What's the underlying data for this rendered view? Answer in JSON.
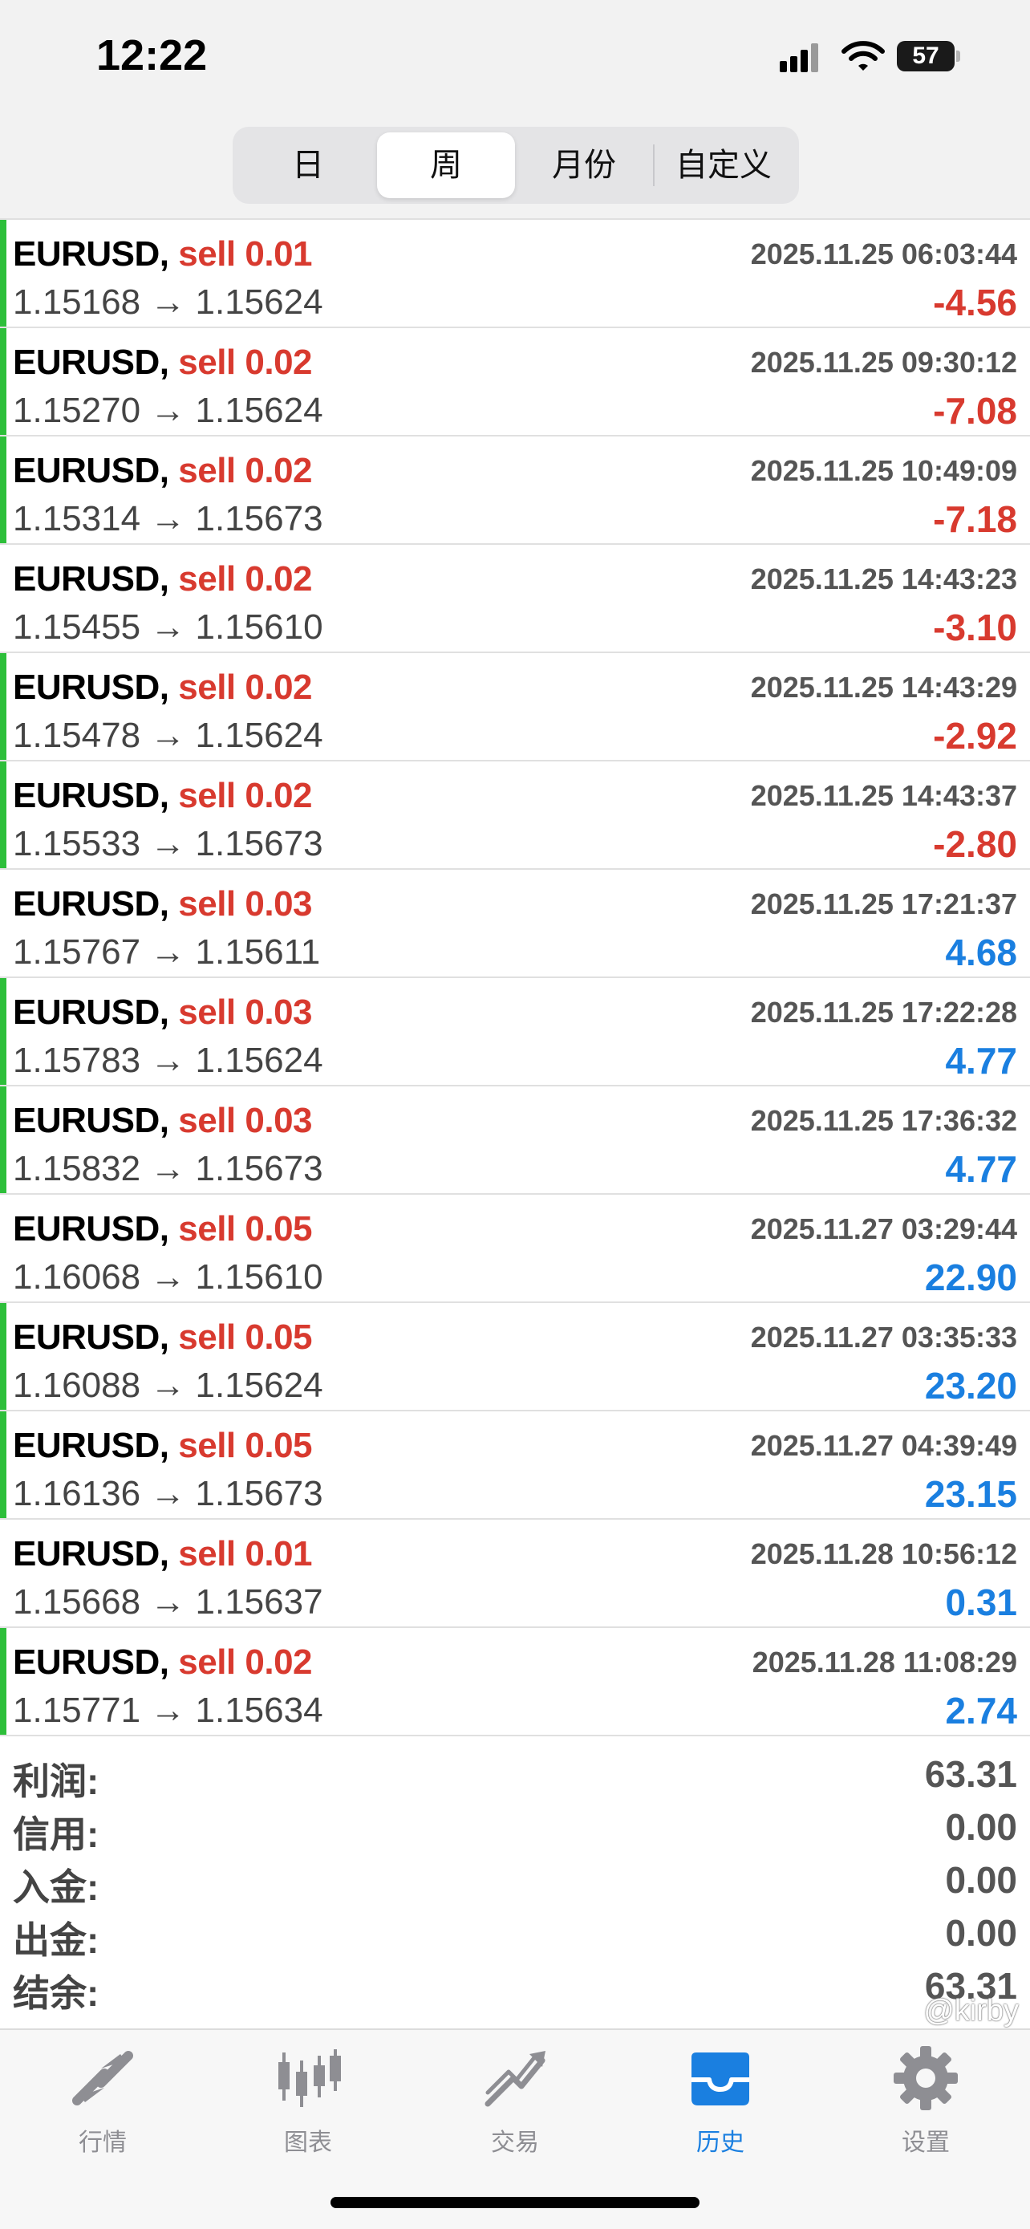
{
  "status_bar": {
    "time": "12:22",
    "battery": "57"
  },
  "segments": [
    {
      "label": "日",
      "active": false
    },
    {
      "label": "周",
      "active": true
    },
    {
      "label": "月份",
      "active": false
    },
    {
      "label": "自定义",
      "active": false
    }
  ],
  "colors": {
    "sell": "#d83a2f",
    "loss": "#d83a2f",
    "gain": "#1a7fe0",
    "side_bar": "#2dbf3a",
    "tab_active": "#1a7fe0"
  },
  "trades": [
    {
      "symbol": "EURUSD,",
      "side": "sell 0.01",
      "prices": "1.15168 → 1.15624",
      "time": "2025.11.25 06:03:44",
      "profit": "-4.56",
      "sign": "neg",
      "bar": true
    },
    {
      "symbol": "EURUSD,",
      "side": "sell 0.02",
      "prices": "1.15270 → 1.15624",
      "time": "2025.11.25 09:30:12",
      "profit": "-7.08",
      "sign": "neg",
      "bar": true
    },
    {
      "symbol": "EURUSD,",
      "side": "sell 0.02",
      "prices": "1.15314 → 1.15673",
      "time": "2025.11.25 10:49:09",
      "profit": "-7.18",
      "sign": "neg",
      "bar": true
    },
    {
      "symbol": "EURUSD,",
      "side": "sell 0.02",
      "prices": "1.15455 → 1.15610",
      "time": "2025.11.25 14:43:23",
      "profit": "-3.10",
      "sign": "neg",
      "bar": false
    },
    {
      "symbol": "EURUSD,",
      "side": "sell 0.02",
      "prices": "1.15478 → 1.15624",
      "time": "2025.11.25 14:43:29",
      "profit": "-2.92",
      "sign": "neg",
      "bar": true
    },
    {
      "symbol": "EURUSD,",
      "side": "sell 0.02",
      "prices": "1.15533 → 1.15673",
      "time": "2025.11.25 14:43:37",
      "profit": "-2.80",
      "sign": "neg",
      "bar": true
    },
    {
      "symbol": "EURUSD,",
      "side": "sell 0.03",
      "prices": "1.15767 → 1.15611",
      "time": "2025.11.25 17:21:37",
      "profit": "4.68",
      "sign": "pos",
      "bar": false
    },
    {
      "symbol": "EURUSD,",
      "side": "sell 0.03",
      "prices": "1.15783 → 1.15624",
      "time": "2025.11.25 17:22:28",
      "profit": "4.77",
      "sign": "pos",
      "bar": true
    },
    {
      "symbol": "EURUSD,",
      "side": "sell 0.03",
      "prices": "1.15832 → 1.15673",
      "time": "2025.11.25 17:36:32",
      "profit": "4.77",
      "sign": "pos",
      "bar": true
    },
    {
      "symbol": "EURUSD,",
      "side": "sell 0.05",
      "prices": "1.16068 → 1.15610",
      "time": "2025.11.27 03:29:44",
      "profit": "22.90",
      "sign": "pos",
      "bar": false
    },
    {
      "symbol": "EURUSD,",
      "side": "sell 0.05",
      "prices": "1.16088 → 1.15624",
      "time": "2025.11.27 03:35:33",
      "profit": "23.20",
      "sign": "pos",
      "bar": true
    },
    {
      "symbol": "EURUSD,",
      "side": "sell 0.05",
      "prices": "1.16136 → 1.15673",
      "time": "2025.11.27 04:39:49",
      "profit": "23.15",
      "sign": "pos",
      "bar": true
    },
    {
      "symbol": "EURUSD,",
      "side": "sell 0.01",
      "prices": "1.15668 → 1.15637",
      "time": "2025.11.28 10:56:12",
      "profit": "0.31",
      "sign": "pos",
      "bar": false
    },
    {
      "symbol": "EURUSD,",
      "side": "sell 0.02",
      "prices": "1.15771 → 1.15634",
      "time": "2025.11.28 11:08:29",
      "profit": "2.74",
      "sign": "pos",
      "bar": true
    }
  ],
  "summary": [
    {
      "label": "利润:",
      "value": "63.31"
    },
    {
      "label": "信用:",
      "value": "0.00"
    },
    {
      "label": "入金:",
      "value": "0.00"
    },
    {
      "label": "出金:",
      "value": "0.00"
    },
    {
      "label": "结余:",
      "value": "63.31"
    }
  ],
  "tabs": [
    {
      "label": "行情",
      "icon": "quotes-arrows-icon",
      "active": false
    },
    {
      "label": "图表",
      "icon": "candlestick-chart-icon",
      "active": false
    },
    {
      "label": "交易",
      "icon": "trade-trend-icon",
      "active": false
    },
    {
      "label": "历史",
      "icon": "history-inbox-icon",
      "active": true
    },
    {
      "label": "设置",
      "icon": "settings-gear-icon",
      "active": false
    }
  ],
  "watermark": "@kirby"
}
